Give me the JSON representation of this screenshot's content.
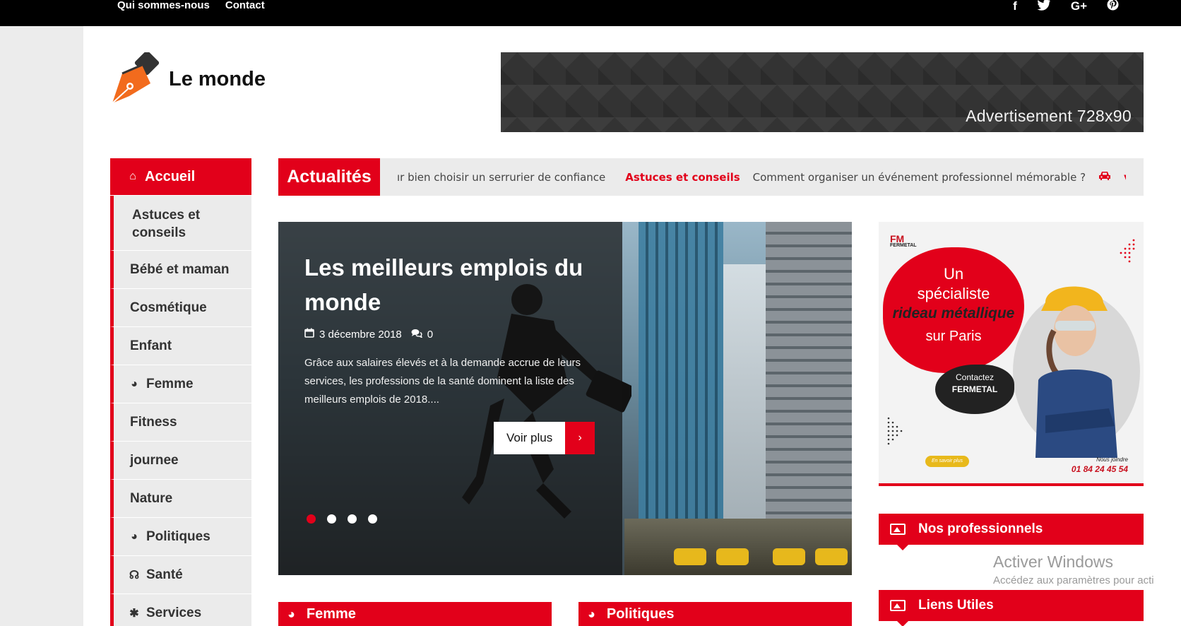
{
  "topbar": {
    "links": [
      "Qui sommes-nous",
      "Contact"
    ],
    "social": [
      {
        "icon": "facebook-icon",
        "glyph": "f"
      },
      {
        "icon": "twitter-icon",
        "glyph": "t"
      },
      {
        "icon": "google-plus-icon",
        "glyph": "G+"
      },
      {
        "icon": "pinterest-icon",
        "glyph": "p"
      }
    ]
  },
  "header": {
    "site_title": "Le monde",
    "ad_text": "Advertisement 728x90"
  },
  "menu": {
    "items": [
      {
        "label": "Accueil",
        "icon": "home-icon",
        "glyph": "⌂"
      },
      {
        "label": "Astuces et conseils"
      },
      {
        "label": "Bébé et maman"
      },
      {
        "label": "Cosmétique"
      },
      {
        "label": "Enfant"
      },
      {
        "label": "Femme",
        "icon": "globe-icon",
        "glyph": "◕"
      },
      {
        "label": "Fitness"
      },
      {
        "label": "journee"
      },
      {
        "label": "Nature"
      },
      {
        "label": "Politiques",
        "icon": "globe-icon",
        "glyph": "◕"
      },
      {
        "label": "Santé",
        "icon": "stethoscope-icon",
        "glyph": "☊"
      },
      {
        "label": "Services",
        "icon": "gear-icon",
        "glyph": "✱"
      }
    ]
  },
  "ticker": {
    "label": "Actualités",
    "item1": "ır bien choisir un serrurier de confiance",
    "category": "Astuces et conseils",
    "item2": "Comment organiser un événement professionnel mémorable ?",
    "trailing": "v"
  },
  "slider": {
    "title": "Les meilleurs emplois du monde",
    "date": "3 décembre 2018",
    "comments": "0",
    "excerpt": "Grâce aux salaires élevés et à la demande accrue de leurs services, les professions de la santé dominent la liste des meilleurs emplois de 2018....",
    "button_label": "Voir plus",
    "dots": 4,
    "active_dot": 1
  },
  "side_ad": {
    "brand": "FM",
    "brand_sub": "FERMETAL",
    "line1": "Un",
    "line2": "spécialiste",
    "line3": "rideau métallique",
    "line4": "sur Paris",
    "contact_label": "Contactez",
    "contact_name": "FERMETAL",
    "pill": "En savoir plus",
    "call_label": "Nous joindre",
    "phone": "01 84 24 45 54"
  },
  "widgets": {
    "pros": "Nos professionnels",
    "links": "Liens Utiles"
  },
  "sections": {
    "femme": "Femme",
    "politiques": "Politiques"
  },
  "windows": {
    "title": "Activer Windows",
    "sub": "Accédez aux paramètres pour acti"
  },
  "colors": {
    "accent": "#e2001a",
    "topbar": "#000000",
    "menu_bg": "#ebebeb"
  }
}
